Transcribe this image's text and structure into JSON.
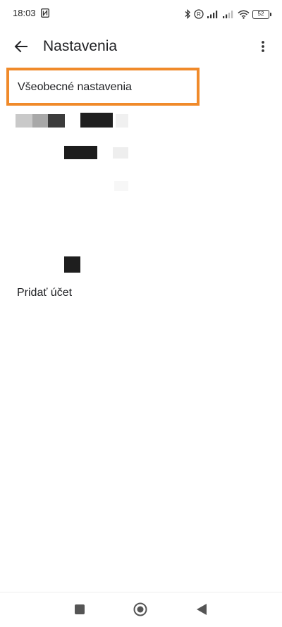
{
  "status_bar": {
    "time": "18:03",
    "battery": "52",
    "icons": [
      "nfc-icon",
      "bluetooth-icon",
      "roaming-icon",
      "signal-icon",
      "signal-icon-2",
      "wifi-icon",
      "battery-icon"
    ]
  },
  "app_bar": {
    "title": "Nastavenia",
    "back_icon": "arrow-left-icon",
    "more_icon": "more-vert-icon"
  },
  "list": {
    "general_settings": "Všeobecné nastavenia",
    "add_account": "Pridať účet"
  },
  "nav_bar": {
    "icons": [
      "recents-square-icon",
      "home-circle-icon",
      "back-triangle-icon"
    ]
  },
  "colors": {
    "highlight": "#f08a2a",
    "text": "#202124"
  }
}
